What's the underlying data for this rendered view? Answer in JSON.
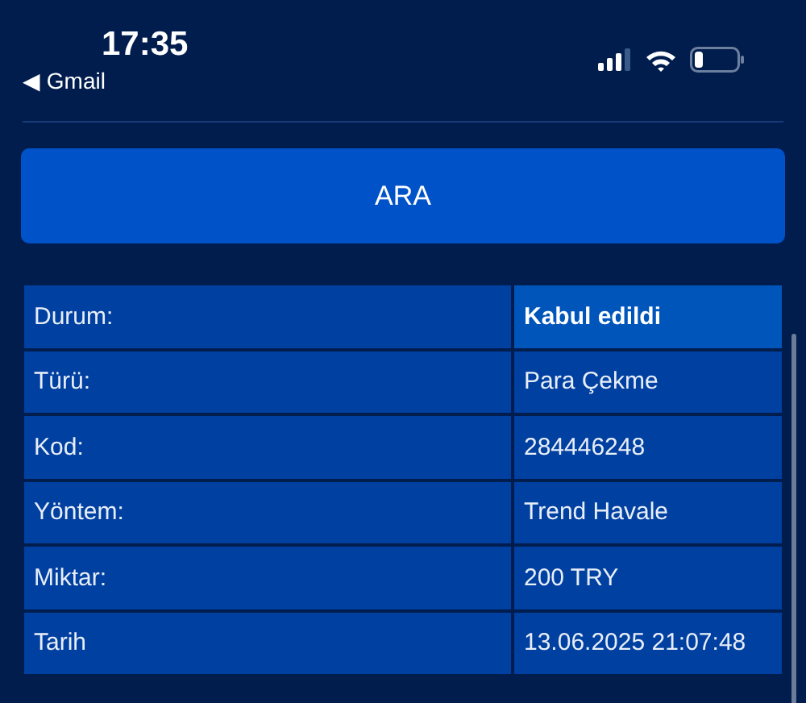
{
  "status_bar": {
    "time": "17:35",
    "back_app": "◀ Gmail"
  },
  "search_button": "ARA",
  "details": [
    {
      "label": "Durum:",
      "value": "Kabul edildi",
      "highlighted": true
    },
    {
      "label": "Türü:",
      "value": "Para Çekme",
      "highlighted": false
    },
    {
      "label": "Kod:",
      "value": "284446248",
      "highlighted": false
    },
    {
      "label": "Yöntem:",
      "value": "Trend Havale",
      "highlighted": false
    },
    {
      "label": "Miktar:",
      "value": "200 TRY",
      "highlighted": false
    },
    {
      "label": "Tarih",
      "value": "13.06.2025 21:07:48",
      "highlighted": false
    }
  ]
}
